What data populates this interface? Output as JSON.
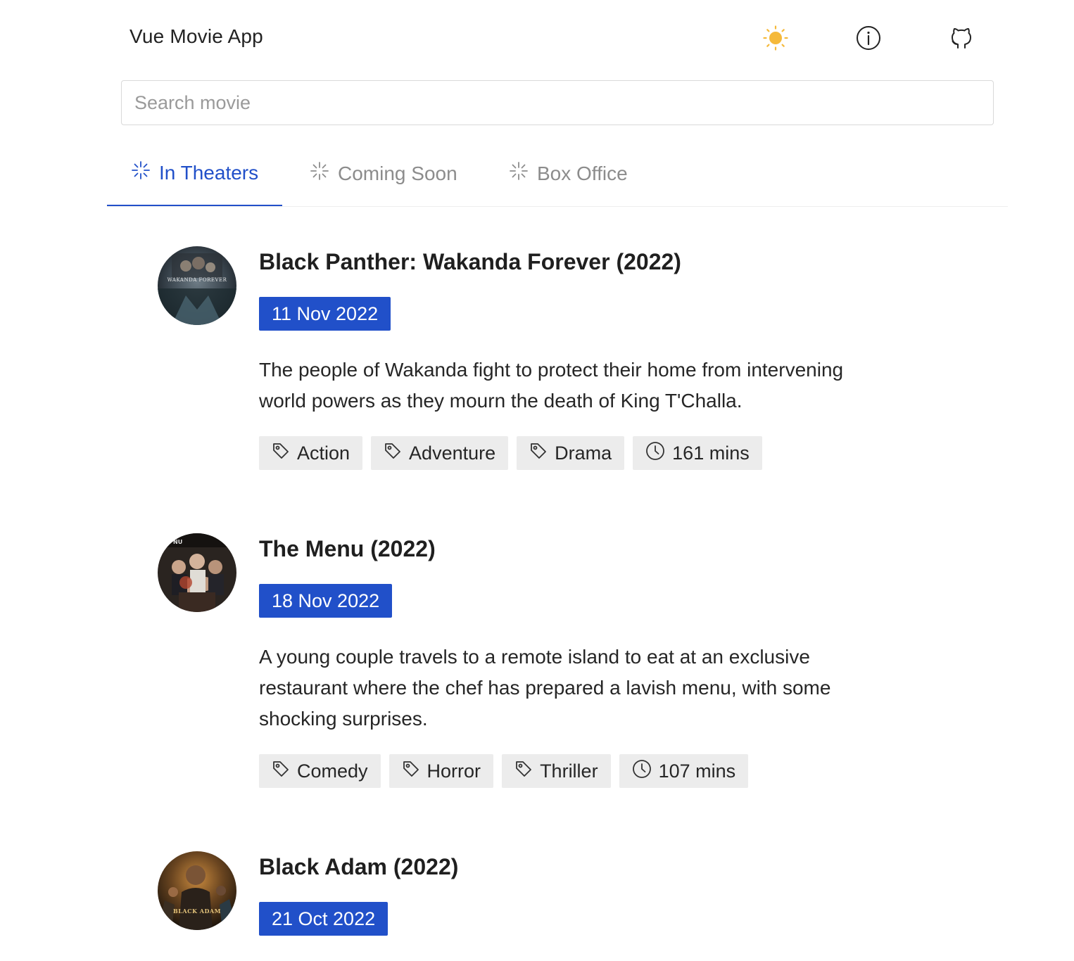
{
  "app": {
    "title": "Vue Movie App",
    "accent_color": "#2150c9",
    "theme_icon": "sun-icon",
    "info_icon": "info-icon",
    "github_icon": "github-icon"
  },
  "search": {
    "placeholder": "Search movie",
    "value": ""
  },
  "tabs": [
    {
      "label": "In Theaters",
      "icon": "sparkle-icon",
      "active": true
    },
    {
      "label": "Coming Soon",
      "icon": "sparkle-icon",
      "active": false
    },
    {
      "label": "Box Office",
      "icon": "sparkle-icon",
      "active": false
    }
  ],
  "movies": [
    {
      "title": "Black Panther: Wakanda Forever (2022)",
      "date": "11 Nov 2022",
      "description": "The people of Wakanda fight to protect their home from intervening world powers as they mourn the death of King T'Challa.",
      "genres": [
        "Action",
        "Adventure",
        "Drama"
      ],
      "runtime": "161 mins",
      "poster_text": "WAKANDA FOREVER"
    },
    {
      "title": "The Menu (2022)",
      "date": "18 Nov 2022",
      "description": "A young couple travels to a remote island to eat at an exclusive restaurant where the chef has prepared a lavish menu, with some shocking surprises.",
      "genres": [
        "Comedy",
        "Horror",
        "Thriller"
      ],
      "runtime": "107 mins",
      "poster_text": "NU"
    },
    {
      "title": "Black Adam (2022)",
      "date": "21 Oct 2022",
      "description": "",
      "genres": [],
      "runtime": "",
      "poster_text": "BLACK ADAM"
    }
  ]
}
